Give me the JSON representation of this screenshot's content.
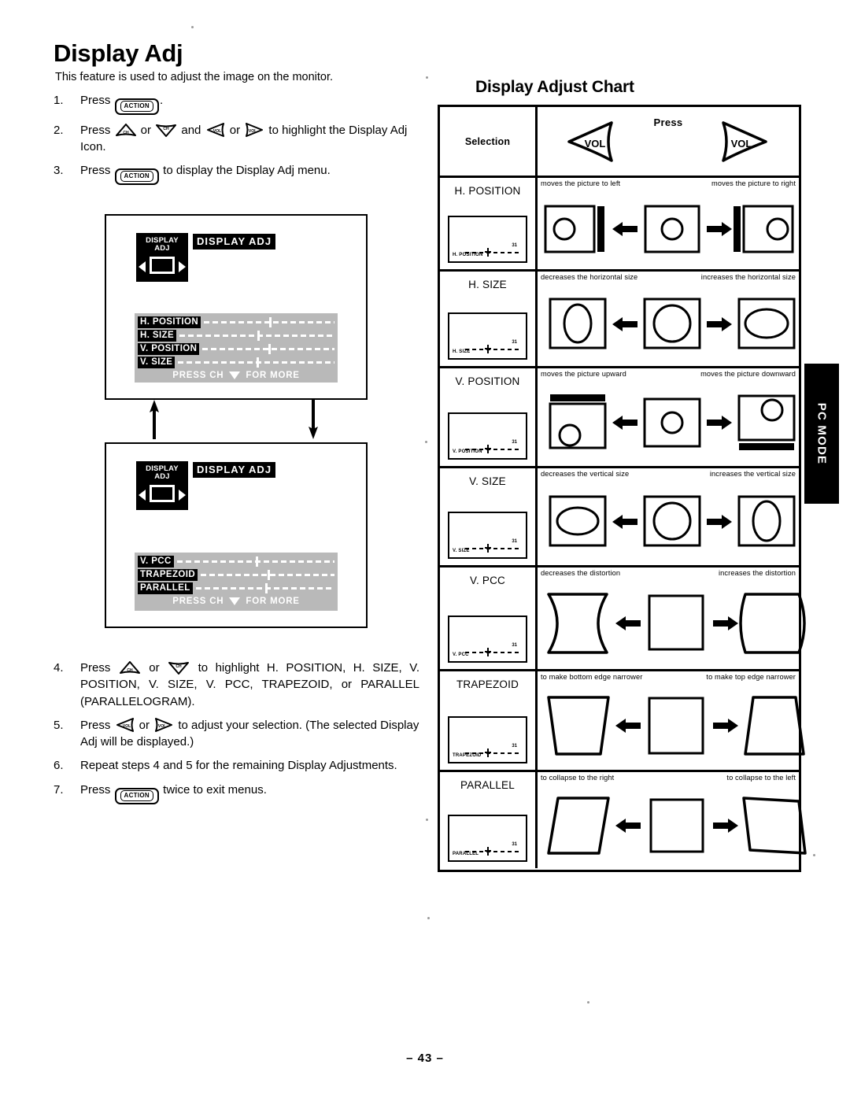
{
  "page": {
    "title": "Display Adj",
    "intro": "This feature is used to adjust the image on the monitor.",
    "folio": "– 43 –",
    "side_tab": "PC MODE"
  },
  "steps": [
    {
      "num": "1.",
      "pre": "Press ",
      "key1": "ACTION",
      "mid": ".",
      "post": ""
    },
    {
      "num": "2.",
      "pre": "Press ",
      "k_up": "CH",
      "or1": " or ",
      "k_dn": "CH",
      "and": " and ",
      "k_lt": "VOL",
      "or2": " or ",
      "k_rt": "VOL",
      "post": " to highlight the Display Adj Icon."
    },
    {
      "num": "3.",
      "pre": "Press ",
      "key1": "ACTION",
      "post": " to display the Display Adj menu."
    },
    {
      "num": "4.",
      "pre": "Press ",
      "k_up": "CH",
      "or1": " or ",
      "k_dn": "CH",
      "post": " to highlight H. POSITION, H. SIZE, V. POSITION, V. SIZE, V. PCC, TRAPEZOID, or PARALLEL (PARALLELOGRAM)."
    },
    {
      "num": "5.",
      "pre": "Press ",
      "k_lt": "VOL",
      "or1": " or ",
      "k_rt": "VOL",
      "post": " to adjust your selection. (The selected Display Adj will be displayed.)"
    },
    {
      "num": "6.",
      "pre": "Repeat steps 4 and 5 for the remaining Display Adjustments.",
      "post": ""
    },
    {
      "num": "7.",
      "pre": "Press ",
      "key1": "ACTION",
      "post": " twice to exit menus."
    }
  ],
  "osd_screens": [
    {
      "icon_label_1": "DISPLAY",
      "icon_label_2": "ADJ",
      "title": "DISPLAY ADJ",
      "rows": [
        "H. POSITION",
        "H. SIZE",
        "V. POSITION",
        "V. SIZE"
      ],
      "footer": "PRESS CH ",
      "footer_tail": " FOR MORE"
    },
    {
      "icon_label_1": "DISPLAY",
      "icon_label_2": "ADJ",
      "title": "DISPLAY ADJ",
      "rows": [
        "V. PCC",
        "TRAPEZOID",
        "PARALLEL"
      ],
      "footer": "PRESS CH ",
      "footer_tail": " FOR MORE"
    }
  ],
  "chart": {
    "title": "Display Adjust Chart",
    "header": {
      "selection": "Selection",
      "press": "Press",
      "key_left": "VOL",
      "key_right": "VOL"
    },
    "rows": [
      {
        "selection": "H. POSITION",
        "osd_label": "H. POSITION",
        "osd_value": "31",
        "caption_left": "moves the picture to left",
        "caption_right": "moves the picture to right"
      },
      {
        "selection": "H. SIZE",
        "osd_label": "H. SIZE",
        "osd_value": "31",
        "caption_left": "decreases the horizontal size",
        "caption_right": "increases the horizontal size"
      },
      {
        "selection": "V. POSITION",
        "osd_label": "V. POSITION",
        "osd_value": "31",
        "caption_left": "moves the picture upward",
        "caption_right": "moves the picture downward"
      },
      {
        "selection": "V. SIZE",
        "osd_label": "V. SIZE",
        "osd_value": "31",
        "caption_left": "decreases the vertical size",
        "caption_right": "increases the vertical size"
      },
      {
        "selection": "V. PCC",
        "osd_label": "V. PCC",
        "osd_value": "31",
        "caption_left": "decreases the distortion",
        "caption_right": "increases the distortion"
      },
      {
        "selection": "TRAPEZOID",
        "osd_label": "TRAPEZOID",
        "osd_value": "31",
        "caption_left": "to make bottom edge narrower",
        "caption_right": "to make top edge narrower"
      },
      {
        "selection": "PARALLEL",
        "osd_label": "PARALLEL",
        "osd_value": "31",
        "caption_left": "to collapse to the right",
        "caption_right": "to collapse to the left"
      }
    ]
  }
}
